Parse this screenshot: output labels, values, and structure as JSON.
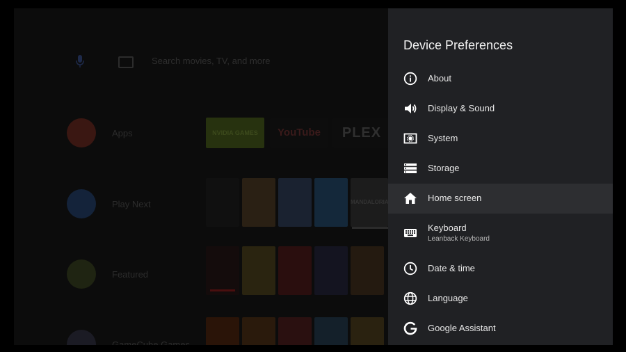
{
  "home": {
    "search_placeholder": "Search movies, TV, and more",
    "rows": {
      "apps": "Apps",
      "play_next": "Play Next",
      "featured": "Featured",
      "gamecube": "GameCube Games"
    },
    "apps": {
      "nvidia": "NVIDIA GAMES",
      "youtube": "YouTube",
      "plex": "PLEX"
    },
    "poster_text": "MANDALORIAN"
  },
  "panel": {
    "title": "Device Preferences",
    "items": [
      {
        "label": "About",
        "icon": "info-icon"
      },
      {
        "label": "Display & Sound",
        "icon": "volume-icon"
      },
      {
        "label": "System",
        "icon": "system-icon"
      },
      {
        "label": "Storage",
        "icon": "storage-icon"
      },
      {
        "label": "Home screen",
        "icon": "home-icon",
        "selected": true
      },
      {
        "label": "Keyboard",
        "sublabel": "Leanback Keyboard",
        "icon": "keyboard-icon"
      },
      {
        "label": "Date & time",
        "icon": "clock-icon"
      },
      {
        "label": "Language",
        "icon": "globe-icon"
      },
      {
        "label": "Google Assistant",
        "icon": "google-icon"
      }
    ]
  },
  "colors": {
    "panel_bg": "#202124",
    "selected_bg": "#2d2e31",
    "text": "#e8e8e8"
  }
}
